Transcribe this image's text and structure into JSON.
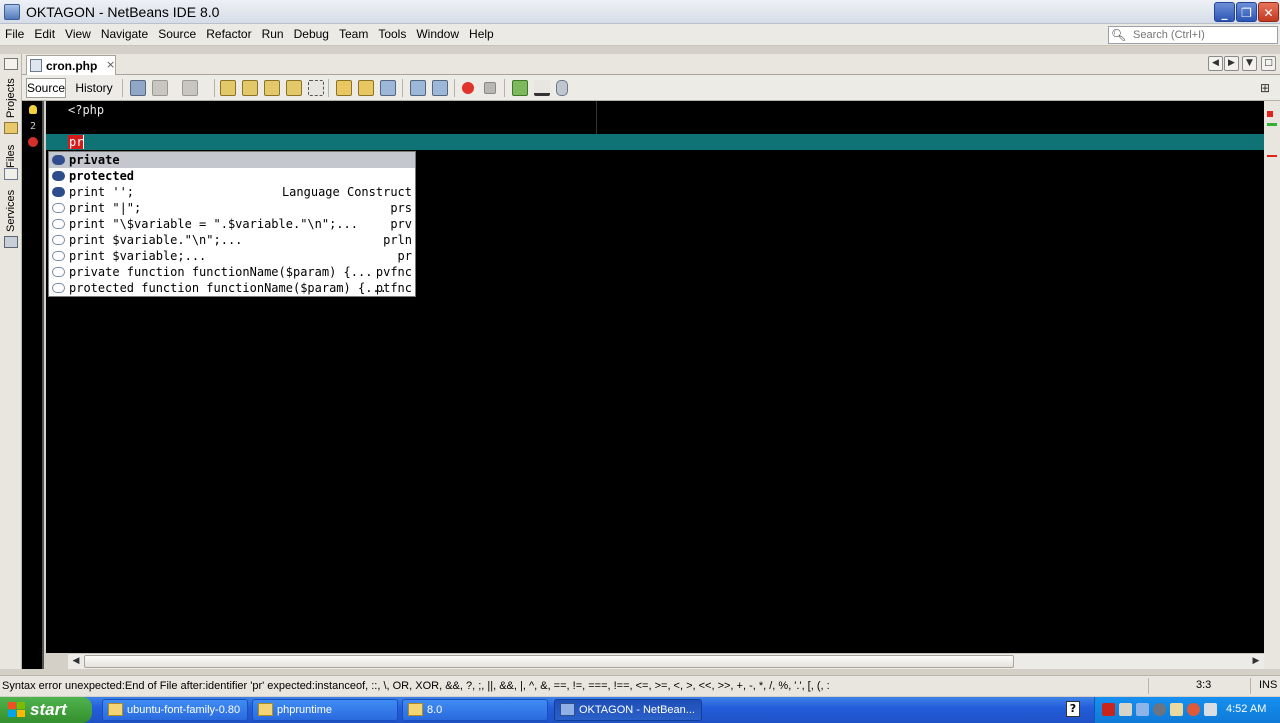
{
  "window": {
    "title": "OKTAGON - NetBeans IDE 8.0",
    "minimize_glyph": "_",
    "maximize_glyph": "❐",
    "close_glyph": "✕"
  },
  "menu": {
    "items": [
      "File",
      "Edit",
      "View",
      "Navigate",
      "Source",
      "Refactor",
      "Run",
      "Debug",
      "Team",
      "Tools",
      "Window",
      "Help"
    ]
  },
  "search": {
    "placeholder": "Search (Ctrl+I)",
    "icon": "magnifier-icon"
  },
  "sidebar": {
    "tabs": [
      "Projects",
      "Files",
      "Services"
    ]
  },
  "editor_tab": {
    "label": "cron.php",
    "close_glyph": "×"
  },
  "tab_nav": {
    "prev_glyph": "◀",
    "next_glyph": "▶",
    "list_glyph": "▼",
    "maximize_glyph": "□"
  },
  "editor_toolbar": {
    "source_label": "Source",
    "history_label": "History"
  },
  "gutter": {
    "line_2": "2"
  },
  "code": {
    "line_1": "<?php",
    "line_3_typed": "pr"
  },
  "completion": {
    "items": [
      {
        "kind": "keyword",
        "text": "private",
        "right": ""
      },
      {
        "kind": "keyword",
        "text": "protected",
        "right": ""
      },
      {
        "kind": "keyword",
        "text": "print '';",
        "right": "Language Construct"
      },
      {
        "kind": "template",
        "text": "print \"|\";",
        "right": "prs"
      },
      {
        "kind": "template",
        "text": "print \"\\$variable = \".$variable.\"\\n\";...",
        "right": "prv"
      },
      {
        "kind": "template",
        "text": "print $variable.\"\\n\";...",
        "right": "prln"
      },
      {
        "kind": "template",
        "text": "print $variable;...",
        "right": "pr"
      },
      {
        "kind": "template",
        "text": "private function functionName($param) {...",
        "right": "pvfnc"
      },
      {
        "kind": "template",
        "text": "protected function functionName($param) {...",
        "right": "ptfnc"
      }
    ]
  },
  "statusbar": {
    "message": "Syntax error  unexpected:End of File  after:identifier 'pr'  expected:instanceof, ::, \\, OR, XOR, &&, ?, ;, ||, &&, |, ^, &, ==, !=, ===, !==, <=, >=, <, >, <<, >>, +, -, *, /, %, '.', [, (, :",
    "position": "3:3",
    "mode": "INS"
  },
  "taskbar": {
    "start_label": "start",
    "tasks": [
      "ubuntu-font-family-0.80",
      "phpruntime",
      "8.0",
      "OKTAGON - NetBean..."
    ],
    "help_glyph": "?",
    "clock": "4:52 AM"
  },
  "colors": {
    "editor_bg": "#000000",
    "current_line": "#0f7274",
    "error_highlight": "#d61a1a",
    "taskbar_blue": "#245edb"
  }
}
